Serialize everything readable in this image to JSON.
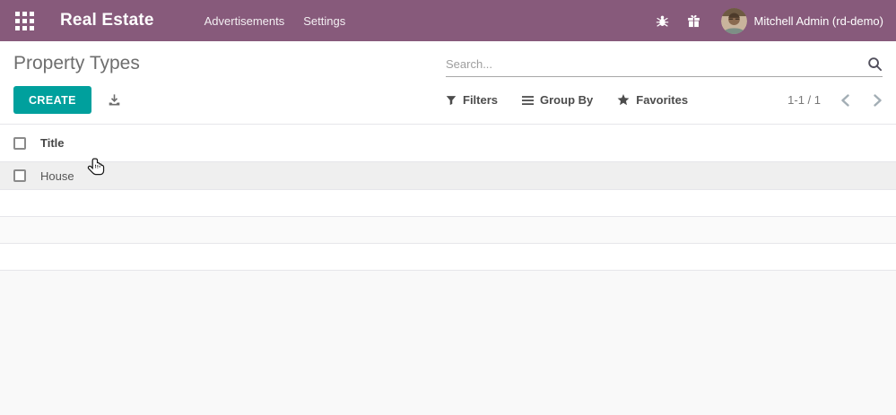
{
  "navbar": {
    "app_title": "Real Estate",
    "menu_items": [
      {
        "label": "Advertisements"
      },
      {
        "label": "Settings"
      }
    ],
    "user_name": "Mitchell Admin (rd-demo)",
    "icons": {
      "apps": "apps-grid-icon",
      "debug": "bug-icon",
      "promo": "gift-icon",
      "avatar": "user-avatar"
    }
  },
  "control_panel": {
    "page_title": "Property Types",
    "search": {
      "placeholder": "Search...",
      "value": "",
      "icon": "magnifier-icon"
    },
    "create_label": "CREATE",
    "export_icon": "download-icon",
    "view_controls": {
      "filters": "Filters",
      "group_by": "Group By",
      "favorites": "Favorites"
    },
    "pager": {
      "display": "1-1 / 1",
      "prev_icon": "chevron-left-icon",
      "next_icon": "chevron-right-icon"
    }
  },
  "list": {
    "columns": [
      {
        "label": "Title"
      }
    ],
    "rows": [
      {
        "title": "House",
        "checked": false
      }
    ]
  },
  "cursor": {
    "type": "hand-pointer"
  },
  "colors": {
    "navbar_bg": "#875a7b",
    "primary": "#00a09d",
    "page_title": "#6e6e6e",
    "row_bg": "#efefef",
    "stripe_bg": "#fafafa",
    "canvas_bg": "#f9f9f9",
    "border": "#e6e6ea",
    "search_underline": "#a8a8a8"
  }
}
